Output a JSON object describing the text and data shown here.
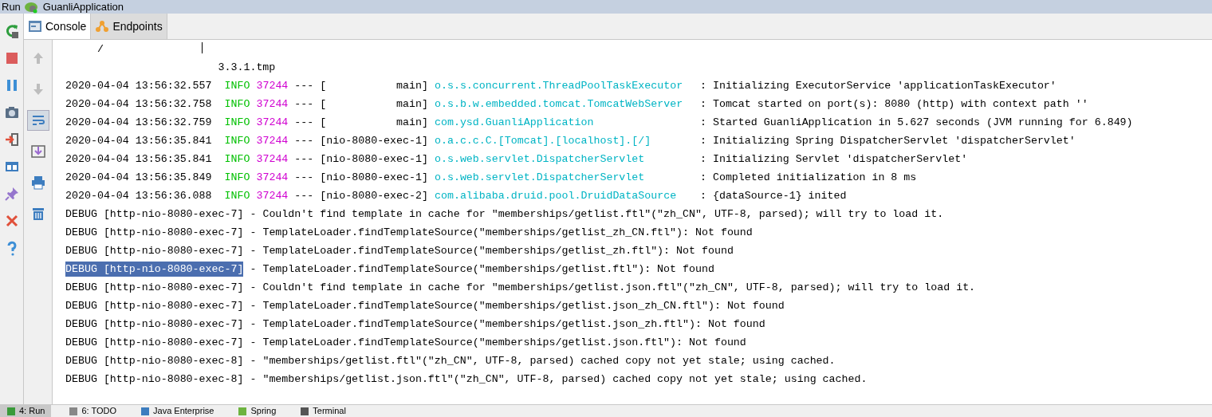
{
  "window": {
    "title": "Run",
    "app": "GuanliApplication"
  },
  "tabs": [
    {
      "label": "Console",
      "selected": true
    },
    {
      "label": "Endpoints",
      "selected": false
    }
  ],
  "lines": [
    {
      "kind": "plain",
      "text": "     /"
    },
    {
      "kind": "plain",
      "text": "                        3.3.1.tmp"
    },
    {
      "kind": "info",
      "time": "2020-04-04 13:56:32.557",
      "level": "INFO",
      "pid": "37244",
      "sep": "---",
      "thread": "[           main]",
      "logger": "o.s.s.concurrent.ThreadPoolTaskExecutor",
      "message": ": Initializing ExecutorService 'applicationTaskExecutor'"
    },
    {
      "kind": "info",
      "time": "2020-04-04 13:56:32.758",
      "level": "INFO",
      "pid": "37244",
      "sep": "---",
      "thread": "[           main]",
      "logger": "o.s.b.w.embedded.tomcat.TomcatWebServer",
      "message": ": Tomcat started on port(s): 8080 (http) with context path ''"
    },
    {
      "kind": "info",
      "time": "2020-04-04 13:56:32.759",
      "level": "INFO",
      "pid": "37244",
      "sep": "---",
      "thread": "[           main]",
      "logger": "com.ysd.GuanliApplication",
      "message": ": Started GuanliApplication in 5.627 seconds (JVM running for 6.849)"
    },
    {
      "kind": "info",
      "time": "2020-04-04 13:56:35.841",
      "level": "INFO",
      "pid": "37244",
      "sep": "---",
      "thread": "[nio-8080-exec-1]",
      "logger": "o.a.c.c.C.[Tomcat].[localhost].[/]",
      "message": ": Initializing Spring DispatcherServlet 'dispatcherServlet'"
    },
    {
      "kind": "info",
      "time": "2020-04-04 13:56:35.841",
      "level": "INFO",
      "pid": "37244",
      "sep": "---",
      "thread": "[nio-8080-exec-1]",
      "logger": "o.s.web.servlet.DispatcherServlet",
      "message": ": Initializing Servlet 'dispatcherServlet'"
    },
    {
      "kind": "info",
      "time": "2020-04-04 13:56:35.849",
      "level": "INFO",
      "pid": "37244",
      "sep": "---",
      "thread": "[nio-8080-exec-1]",
      "logger": "o.s.web.servlet.DispatcherServlet",
      "message": ": Completed initialization in 8 ms"
    },
    {
      "kind": "info",
      "time": "2020-04-04 13:56:36.088",
      "level": "INFO",
      "pid": "37244",
      "sep": "---",
      "thread": "[nio-8080-exec-2]",
      "logger": "com.alibaba.druid.pool.DruidDataSource",
      "message": ": {dataSource-1} inited"
    },
    {
      "kind": "debug",
      "prefix": "DEBUG [http-nio-8080-exec-7]",
      "selected": false,
      "message": "- Couldn't find template in cache for \"memberships/getlist.ftl\"(\"zh_CN\", UTF-8, parsed); will try to load it."
    },
    {
      "kind": "debug",
      "prefix": "DEBUG [http-nio-8080-exec-7]",
      "selected": false,
      "message": "- TemplateLoader.findTemplateSource(\"memberships/getlist_zh_CN.ftl\"): Not found"
    },
    {
      "kind": "debug",
      "prefix": "DEBUG [http-nio-8080-exec-7]",
      "selected": false,
      "message": "- TemplateLoader.findTemplateSource(\"memberships/getlist_zh.ftl\"): Not found"
    },
    {
      "kind": "debug",
      "prefix": "DEBUG [http-nio-8080-exec-7]",
      "selected": true,
      "message": "- TemplateLoader.findTemplateSource(\"memberships/getlist.ftl\"): Not found"
    },
    {
      "kind": "debug",
      "prefix": "DEBUG [http-nio-8080-exec-7]",
      "selected": false,
      "message": "- Couldn't find template in cache for \"memberships/getlist.json.ftl\"(\"zh_CN\", UTF-8, parsed); will try to load it."
    },
    {
      "kind": "debug",
      "prefix": "DEBUG [http-nio-8080-exec-7]",
      "selected": false,
      "message": "- TemplateLoader.findTemplateSource(\"memberships/getlist.json_zh_CN.ftl\"): Not found"
    },
    {
      "kind": "debug",
      "prefix": "DEBUG [http-nio-8080-exec-7]",
      "selected": false,
      "message": "- TemplateLoader.findTemplateSource(\"memberships/getlist.json_zh.ftl\"): Not found"
    },
    {
      "kind": "debug",
      "prefix": "DEBUG [http-nio-8080-exec-7]",
      "selected": false,
      "message": "- TemplateLoader.findTemplateSource(\"memberships/getlist.json.ftl\"): Not found"
    },
    {
      "kind": "debug",
      "prefix": "DEBUG [http-nio-8080-exec-8]",
      "selected": false,
      "message": "- \"memberships/getlist.ftl\"(\"zh_CN\", UTF-8, parsed) cached copy not yet stale; using cached."
    },
    {
      "kind": "debug",
      "prefix": "DEBUG [http-nio-8080-exec-8]",
      "selected": false,
      "message": "- \"memberships/getlist.json.ftl\"(\"zh_CN\", UTF-8, parsed) cached copy not yet stale; using cached."
    }
  ],
  "bottom_tabs": [
    {
      "label": "4: Run",
      "selected": true
    },
    {
      "label": "6: TODO",
      "selected": false
    },
    {
      "label": "Java Enterprise",
      "selected": false
    },
    {
      "label": "Spring",
      "selected": false
    },
    {
      "label": "Terminal",
      "selected": false
    }
  ]
}
